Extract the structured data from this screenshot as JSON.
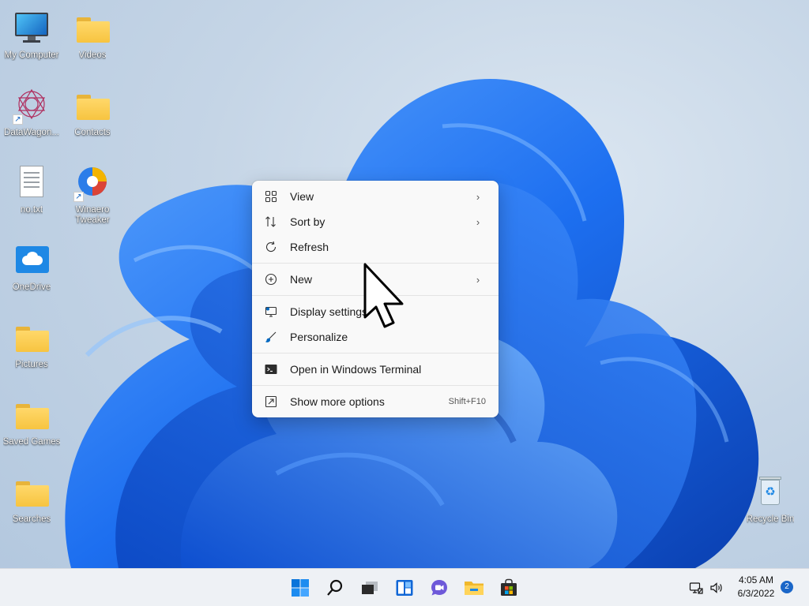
{
  "desktop": {
    "icons": [
      {
        "label": "My Computer"
      },
      {
        "label": "Videos"
      },
      {
        "label": "DataWagon..."
      },
      {
        "label": "Contacts"
      },
      {
        "label": "no.txt"
      },
      {
        "label": "Winaero Tweaker"
      },
      {
        "label": "OneDrive"
      },
      {
        "label": "Pictures"
      },
      {
        "label": "Saved Games"
      },
      {
        "label": "Searches"
      },
      {
        "label": "Recycle Bin"
      }
    ]
  },
  "context_menu": {
    "items": [
      {
        "label": "View",
        "icon": "grid-icon",
        "submenu": true
      },
      {
        "label": "Sort by",
        "icon": "sort-arrows-icon",
        "submenu": true
      },
      {
        "label": "Refresh",
        "icon": "refresh-icon"
      },
      {
        "label": "New",
        "icon": "plus-circle-icon",
        "submenu": true
      },
      {
        "label": "Display settings",
        "icon": "display-settings-icon"
      },
      {
        "label": "Personalize",
        "icon": "brush-icon"
      },
      {
        "label": "Open in Windows Terminal",
        "icon": "terminal-icon"
      },
      {
        "label": "Show more options",
        "icon": "expand-icon",
        "shortcut": "Shift+F10"
      }
    ]
  },
  "taskbar": {
    "apps": [
      "start-icon",
      "search-icon",
      "task-view-icon",
      "widgets-icon",
      "chat-icon",
      "file-explorer-icon",
      "store-icon"
    ],
    "clock": {
      "time": "4:05 AM",
      "date": "6/3/2022"
    },
    "notifications": "2"
  },
  "colors": {
    "accent": "#0067c0",
    "wallpaper_blue": "#1f6fe6",
    "menu_bg": "#f9f9f9"
  }
}
